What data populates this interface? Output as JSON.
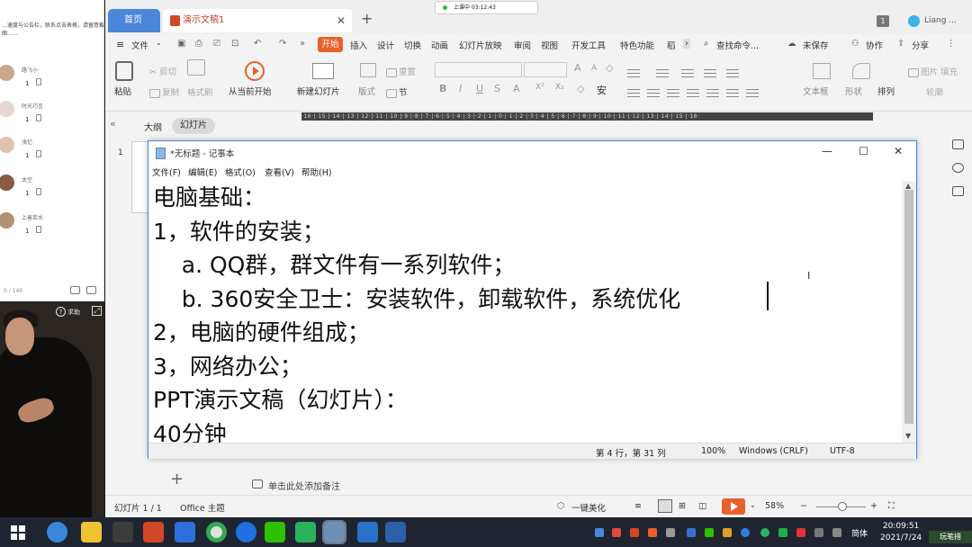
{
  "chat": {
    "notice": "…速度与公告栏，联系点击表格，请留意截图……",
    "members": [
      {
        "name": "路飞小·",
        "count": "1"
      },
      {
        "name": "时光巧言",
        "count": "1"
      },
      {
        "name": "浅忆",
        "count": "1"
      },
      {
        "name": "太空",
        "count": "1"
      },
      {
        "name": "上善若水",
        "count": "1"
      }
    ],
    "char_count": "0 / 140"
  },
  "video": {
    "help_label": "求助"
  },
  "wps": {
    "tabs": {
      "home": "首页",
      "doc": "演示文稿1"
    },
    "recording": "上课中 03:12:43",
    "user_count": "1",
    "user_name": "Liang ...",
    "menu": {
      "file": "文件",
      "start": "开始",
      "items": [
        "插入",
        "设计",
        "切换",
        "动画",
        "幻灯片放映",
        "审阅",
        "视图",
        "开发工具",
        "特色功能",
        "稻"
      ],
      "search": "查找命令...",
      "unsaved": "未保存",
      "collab": "协作",
      "share": "分享"
    },
    "ribbon": {
      "paste": "粘贴",
      "cut": "剪切",
      "copy": "复制",
      "format_painter": "格式刷",
      "from_current": "从当前开始",
      "new_slide": "新建幻灯片",
      "layout": "版式",
      "section": "节",
      "reset": "重置",
      "text_box": "文本框",
      "shape": "形状",
      "arrange": "排列",
      "picture": "图片",
      "fill": "填充",
      "outline": "轮廓"
    },
    "view": {
      "outline": "大纲",
      "slides": "幻灯片"
    },
    "ruler": "·16·|·15·|·14·|·13·|·12·|·11·|·10·|·9·|·8·|·7·|·6·|·5·|·4·|·3·|·2·|·1·|·0·|·1·|·2·|·3·|·4·|·5·|·6·|·7·|·8·|·9·|·10·|·11·|·12·|·13·|·14·|·15·|·16·",
    "slide_number": "1",
    "notes_placeholder": "单击此处添加备注",
    "status": {
      "slide": "幻灯片 1 / 1",
      "theme": "Office 主题",
      "beautify": "一键美化",
      "zoom": "58%"
    }
  },
  "notepad": {
    "title": "*无标题 - 记事本",
    "menu": [
      "文件(F)",
      "编辑(E)",
      "格式(O)",
      "查看(V)",
      "帮助(H)"
    ],
    "lines": [
      "电脑基础：",
      "1，软件的安装；",
      "    a. QQ群，群文件有一系列软件；",
      "    b. 360安全卫士：安装软件，卸载软件，系统优化",
      "2，电脑的硬件组成；",
      "3，网络办公；",
      "PPT演示文稿（幻灯片）：",
      "40分钟"
    ],
    "status": {
      "position": "第 4 行，第 31 列",
      "zoom": "100%",
      "eol": "Windows (CRLF)",
      "encoding": "UTF-8"
    }
  },
  "taskbar": {
    "ime": "简体",
    "time": "20:09:51",
    "date": "2021/7/24",
    "corner": "玩笔措"
  },
  "colors": {
    "wps_accent": "#e8602c",
    "home_tab": "#4a86d9",
    "taskbar": "#1f2530"
  }
}
